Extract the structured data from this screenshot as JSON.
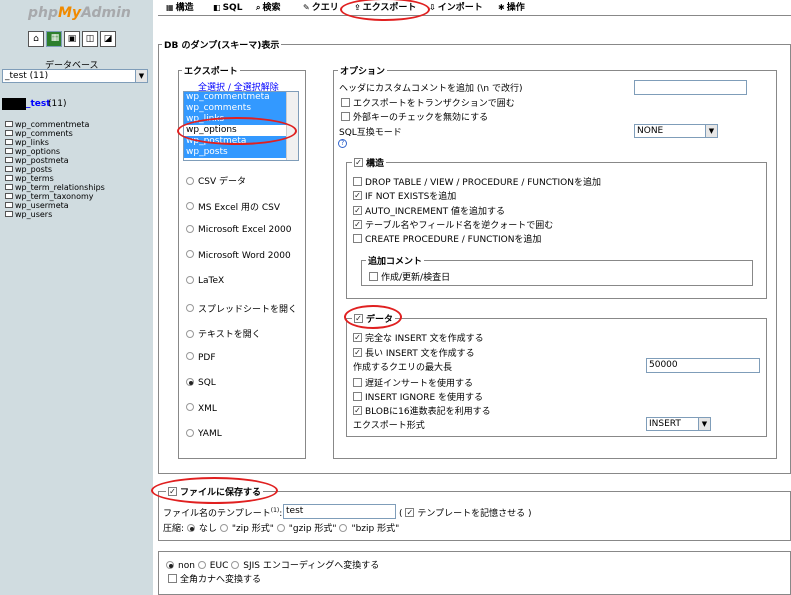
{
  "sidebar": {
    "logo_php": "php",
    "logo_my": "My",
    "logo_admin": "Admin",
    "icons": [
      "home-icon",
      "sql-icon",
      "settings-icon",
      "docs-icon",
      "query-icon"
    ],
    "db_label": "データベース",
    "db_select": "_test (11)",
    "db_name": "_test",
    "db_count": "(11)",
    "tables": [
      "wp_commentmeta",
      "wp_comments",
      "wp_links",
      "wp_options",
      "wp_postmeta",
      "wp_posts",
      "wp_terms",
      "wp_term_relationships",
      "wp_term_taxonomy",
      "wp_usermeta",
      "wp_users"
    ]
  },
  "tabs": [
    {
      "icon": "▦",
      "label": "構造"
    },
    {
      "icon": "◧",
      "label": "SQL"
    },
    {
      "icon": "⌕",
      "label": "検索"
    },
    {
      "icon": "✎",
      "label": "クエリ"
    },
    {
      "icon": "⇪",
      "label": "エクスポート"
    },
    {
      "icon": "⇩",
      "label": "インポート"
    },
    {
      "icon": "✱",
      "label": "操作"
    }
  ],
  "dump": {
    "title": "DB のダンプ(スキーマ)表示",
    "export": {
      "legend": "エクスポート",
      "select_all": "全選択",
      "sep": " / ",
      "deselect_all": "全選択解除",
      "list": [
        {
          "label": "wp_commentmeta",
          "selected": true
        },
        {
          "label": "wp_comments",
          "selected": true
        },
        {
          "label": "wp_links",
          "selected": true
        },
        {
          "label": "wp_options",
          "selected": false
        },
        {
          "label": "wp_postmeta",
          "selected": true
        },
        {
          "label": "wp_posts",
          "selected": true
        }
      ],
      "formats": [
        "CSV データ",
        "MS Excel 用の CSV",
        "Microsoft Excel 2000",
        "Microsoft Word 2000",
        "LaTeX",
        "スプレッドシートを開く",
        "テキストを開く",
        "PDF",
        "SQL",
        "XML",
        "YAML"
      ],
      "selected_format": "SQL"
    },
    "options": {
      "legend": "オプション",
      "header_comment_label": "ヘッダにカスタムコメントを追加 (\\n で改行)",
      "header_comment_value": "",
      "transaction": "エクスポートをトランザクションで囲む",
      "fk_checks": "外部キーのチェックを無効にする",
      "compat_label": "SQL互換モード",
      "compat_value": "NONE",
      "help_icon": "?",
      "structure": {
        "legend": "構造",
        "items": [
          {
            "label": "DROP TABLE / VIEW / PROCEDURE / FUNCTIONを追加",
            "checked": false
          },
          {
            "label": "IF NOT EXISTSを追加",
            "checked": true
          },
          {
            "label": "AUTO_INCREMENT 値を追加する",
            "checked": true
          },
          {
            "label": "テーブル名やフィールド名を逆クォートで囲む",
            "checked": true
          },
          {
            "label": "CREATE PROCEDURE / FUNCTIONを追加",
            "checked": false
          }
        ],
        "comments_legend": "追加コメント",
        "comments_item": "作成/更新/検査日"
      },
      "data": {
        "legend": "データ",
        "complete_insert": "完全な INSERT 文を作成する",
        "extended_insert": "長い INSERT 文を作成する",
        "max_query_label": "作成するクエリの最大長",
        "max_query_value": "50000",
        "delayed": "遅延インサートを使用する",
        "ignore": "INSERT IGNORE を使用する",
        "hex": "BLOBに16進数表記を利用する",
        "export_type_label": "エクスポート形式",
        "export_type_value": "INSERT"
      }
    }
  },
  "save": {
    "label": "ファイルに保存する",
    "template_label": "ファイル名のテンプレート",
    "template_sup": "(1)",
    "template_colon": ":",
    "template_value": "test",
    "remember": "テンプレートを記憶させる",
    "paren_open": "(",
    "paren_close": ")",
    "compress_label": "圧縮:",
    "compress": [
      "なし",
      "\"zip 形式\"",
      "\"gzip 形式\"",
      "\"bzip 形式\""
    ]
  },
  "encoding": {
    "options": [
      "non",
      "EUC",
      "SJIS"
    ],
    "label": "エンコーディングへ変換する",
    "kana": "全角カナへ変換する"
  }
}
